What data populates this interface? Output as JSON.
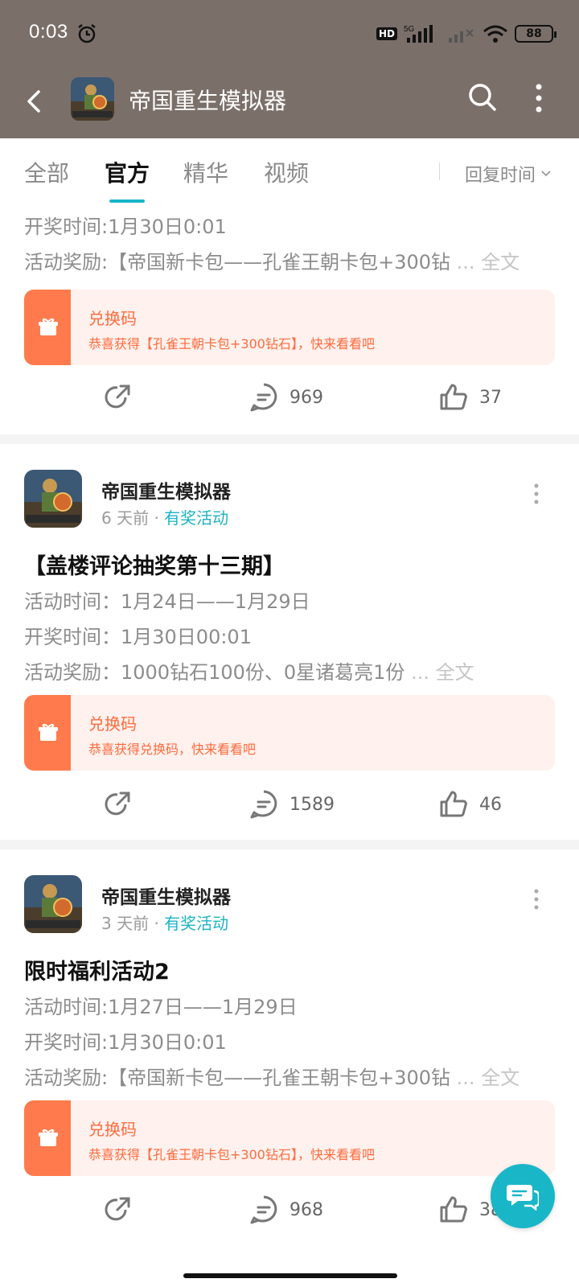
{
  "status": {
    "time": "0:03",
    "network": "5G",
    "hd": "HD",
    "battery": "88"
  },
  "nav": {
    "title": "帝国重生模拟器"
  },
  "tabs": [
    {
      "label": "全部"
    },
    {
      "label": "官方"
    },
    {
      "label": "精华"
    },
    {
      "label": "视频"
    }
  ],
  "sort": {
    "label": "回复时间"
  },
  "fulltext": "全文",
  "ellipsis": "...",
  "post0": {
    "lines": [
      "开奖时间:1月30日0:01",
      "活动奖励:【帝国新卡包——孔雀王朝卡包+300钻"
    ],
    "redeem_title": "兑换码",
    "redeem_sub": "恭喜获得【孔雀王朝卡包+300钻石】，快来看看吧",
    "comments": "969",
    "likes": "37"
  },
  "post1": {
    "author": "帝国重生模拟器",
    "age": "6 天前",
    "dot": "·",
    "tag": "有奖活动",
    "title": "【盖楼评论抽奖第十三期】",
    "lines": [
      "活动时间：1月24日——1月29日",
      "开奖时间：1月30日00:01",
      "活动奖励：1000钻石100份、0星诸葛亮1份"
    ],
    "redeem_title": "兑换码",
    "redeem_sub": "恭喜获得兑换码，快来看看吧",
    "comments": "1589",
    "likes": "46"
  },
  "post2": {
    "author": "帝国重生模拟器",
    "age": "3 天前",
    "dot": "·",
    "tag": "有奖活动",
    "title": "限时福利活动2",
    "lines": [
      "活动时间:1月27日——1月29日",
      "开奖时间:1月30日0:01",
      "活动奖励:【帝国新卡包——孔雀王朝卡包+300钻"
    ],
    "redeem_title": "兑换码",
    "redeem_sub": "恭喜获得【孔雀王朝卡包+300钻石】，快来看看吧",
    "comments": "968",
    "likes": "38"
  },
  "colors": {
    "header": "#7b6f6a",
    "accent": "#19b6c8",
    "redeem": "#ff7b4d",
    "redeem_bg": "#fff1ee"
  },
  "icons": [
    "back-icon",
    "search-icon",
    "more-icon",
    "share-icon",
    "comment-icon",
    "like-icon",
    "gift-icon",
    "chat-fab-icon"
  ]
}
